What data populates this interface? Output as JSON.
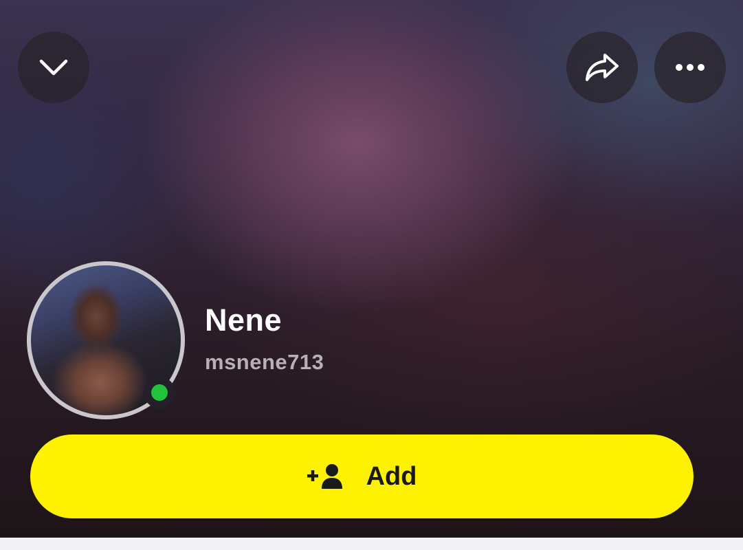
{
  "header": {
    "collapse_icon": "chevron-down-icon",
    "share_icon": "share-arrow-icon",
    "more_icon": "more-dots-icon"
  },
  "profile": {
    "display_name": "Nene",
    "username": "msnene713",
    "online": true,
    "online_color": "#22c33c"
  },
  "actions": {
    "add_label": "Add",
    "add_icon": "add-friend-icon",
    "add_color": "#fff200"
  }
}
